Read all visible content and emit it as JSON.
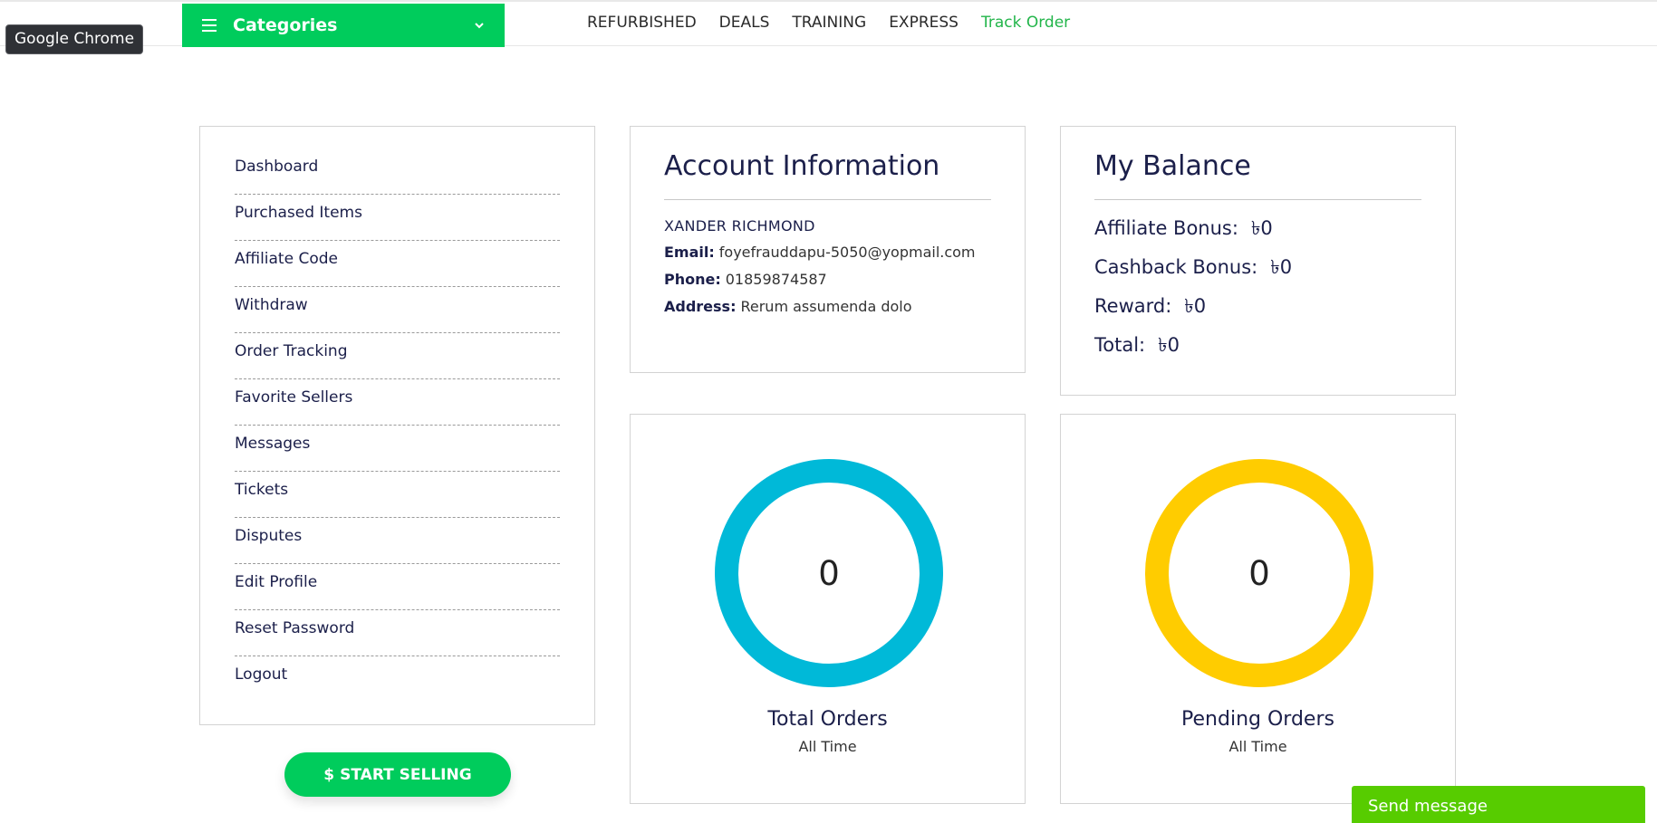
{
  "tooltip": {
    "text": "Google Chrome"
  },
  "header": {
    "categories_label": "Categories",
    "nav": [
      "REFURBISHED",
      "DEALS",
      "TRAINING",
      "EXPRESS",
      "Track Order"
    ],
    "active_nav": "Track Order"
  },
  "sidebar": {
    "items": [
      "Dashboard",
      "Purchased Items",
      "Affiliate Code",
      "Withdraw",
      "Order Tracking",
      "Favorite Sellers",
      "Messages",
      "Tickets",
      "Disputes",
      "Edit Profile",
      "Reset Password",
      "Logout"
    ],
    "start_selling_icon": "$",
    "start_selling_label": "START SELLING"
  },
  "account": {
    "title": "Account Information",
    "name": "XANDER RICHMOND",
    "email_label": "Email:",
    "email": "foyefrauddapu-5050@yopmail.com",
    "phone_label": "Phone:",
    "phone": "01859874587",
    "address_label": "Address:",
    "address": "Rerum assumenda dolo"
  },
  "balance": {
    "title": "My Balance",
    "rows": [
      {
        "label": "Affiliate Bonus:",
        "value": "৳0"
      },
      {
        "label": "Cashback Bonus:",
        "value": "৳0"
      },
      {
        "label": "Reward:",
        "value": "৳0"
      },
      {
        "label": "Total:",
        "value": "৳0"
      }
    ]
  },
  "stats": {
    "total": {
      "value": "0",
      "title": "Total Orders",
      "subtitle": "All Time",
      "color": "#00b9d8"
    },
    "pending": {
      "value": "0",
      "title": "Pending Orders",
      "subtitle": "All Time",
      "color": "#ffcc00"
    }
  },
  "chat": {
    "label": "Send message"
  },
  "colors": {
    "brand_green": "#00cc5c",
    "chat_green": "#57cc00",
    "text_navy": "#1b1f4a"
  },
  "icons": {
    "menu": "hamburger-icon",
    "dropdown": "chevron-down-icon",
    "dollar": "dollar-icon"
  }
}
